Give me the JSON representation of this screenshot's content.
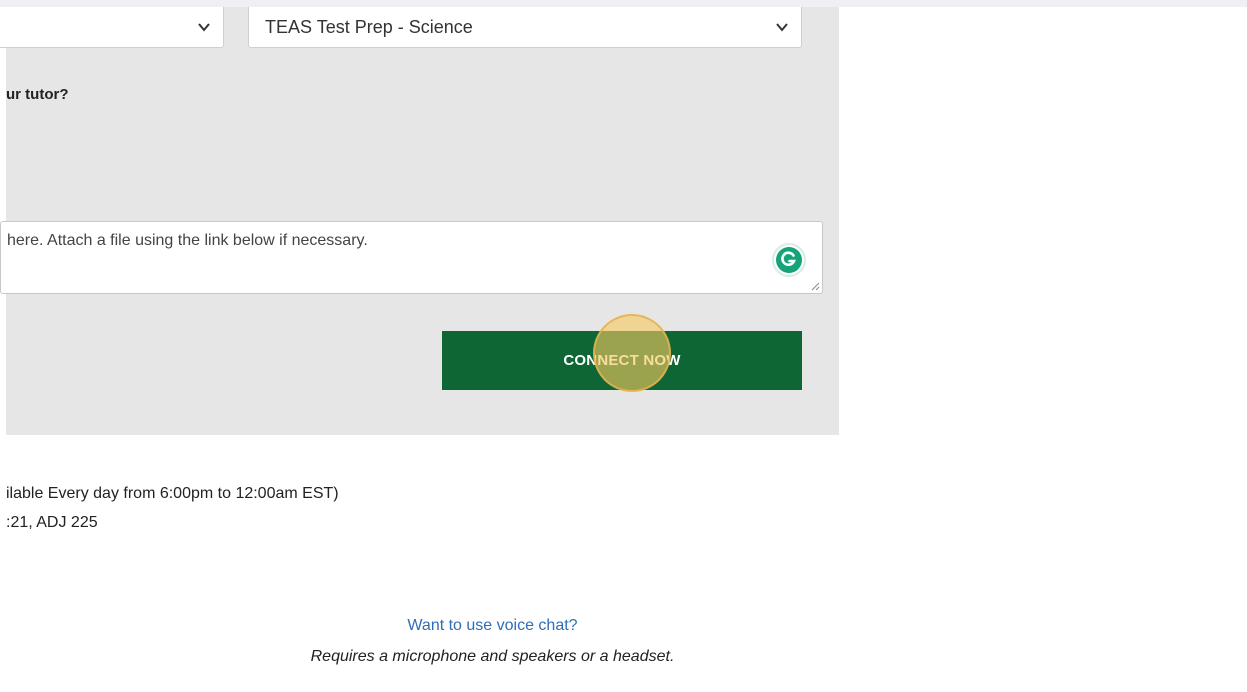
{
  "form": {
    "topic_select_left": {
      "value": ""
    },
    "subject_select": {
      "value": "TEAS Test Prep - Science"
    },
    "question_label": "ur tutor?",
    "message_textarea": {
      "placeholder": "here.  Attach a file using the link below if necessary."
    },
    "connect_button_label": "CONNECT NOW"
  },
  "availability": {
    "line_1": "ilable Every day from 6:00pm to 12:00am EST)",
    "line_2": ":21, ADJ 225"
  },
  "voice_chat": {
    "link_text": "Want to use voice chat?",
    "note": "Requires a microphone and speakers or a headset."
  },
  "icons": {
    "chevron": "chevron-down-icon",
    "grammarly": "grammarly-icon",
    "resize": "resize-handle-icon"
  },
  "colors": {
    "primary_button": "#0d6633",
    "panel_background": "#e6e6e6",
    "link": "#2f6db5",
    "grammarly": "#15a37a"
  }
}
